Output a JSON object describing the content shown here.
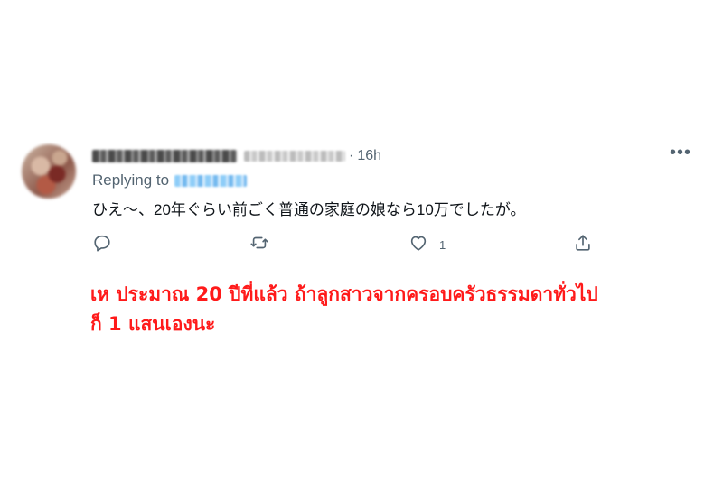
{
  "tweet": {
    "time_sep": "·",
    "time": "16h",
    "replying_to_label": "Replying to",
    "text": "ひえ〜、20年ぐらい前ごく普通の家庭の娘なら10万でしたが。",
    "more_label": "•••",
    "like_count": "1",
    "actions": {
      "reply_icon": "reply-icon",
      "retweet_icon": "retweet-icon",
      "like_icon": "heart-icon",
      "share_icon": "share-icon"
    }
  },
  "caption": {
    "line1": "เห ประมาณ 20 ปีที่แล้ว ถ้าลูกสาวจากครอบครัวธรรมดาทั่วไป",
    "line2": "ก็ 1 แสนเองนะ",
    "color": "#ff1a1a"
  }
}
